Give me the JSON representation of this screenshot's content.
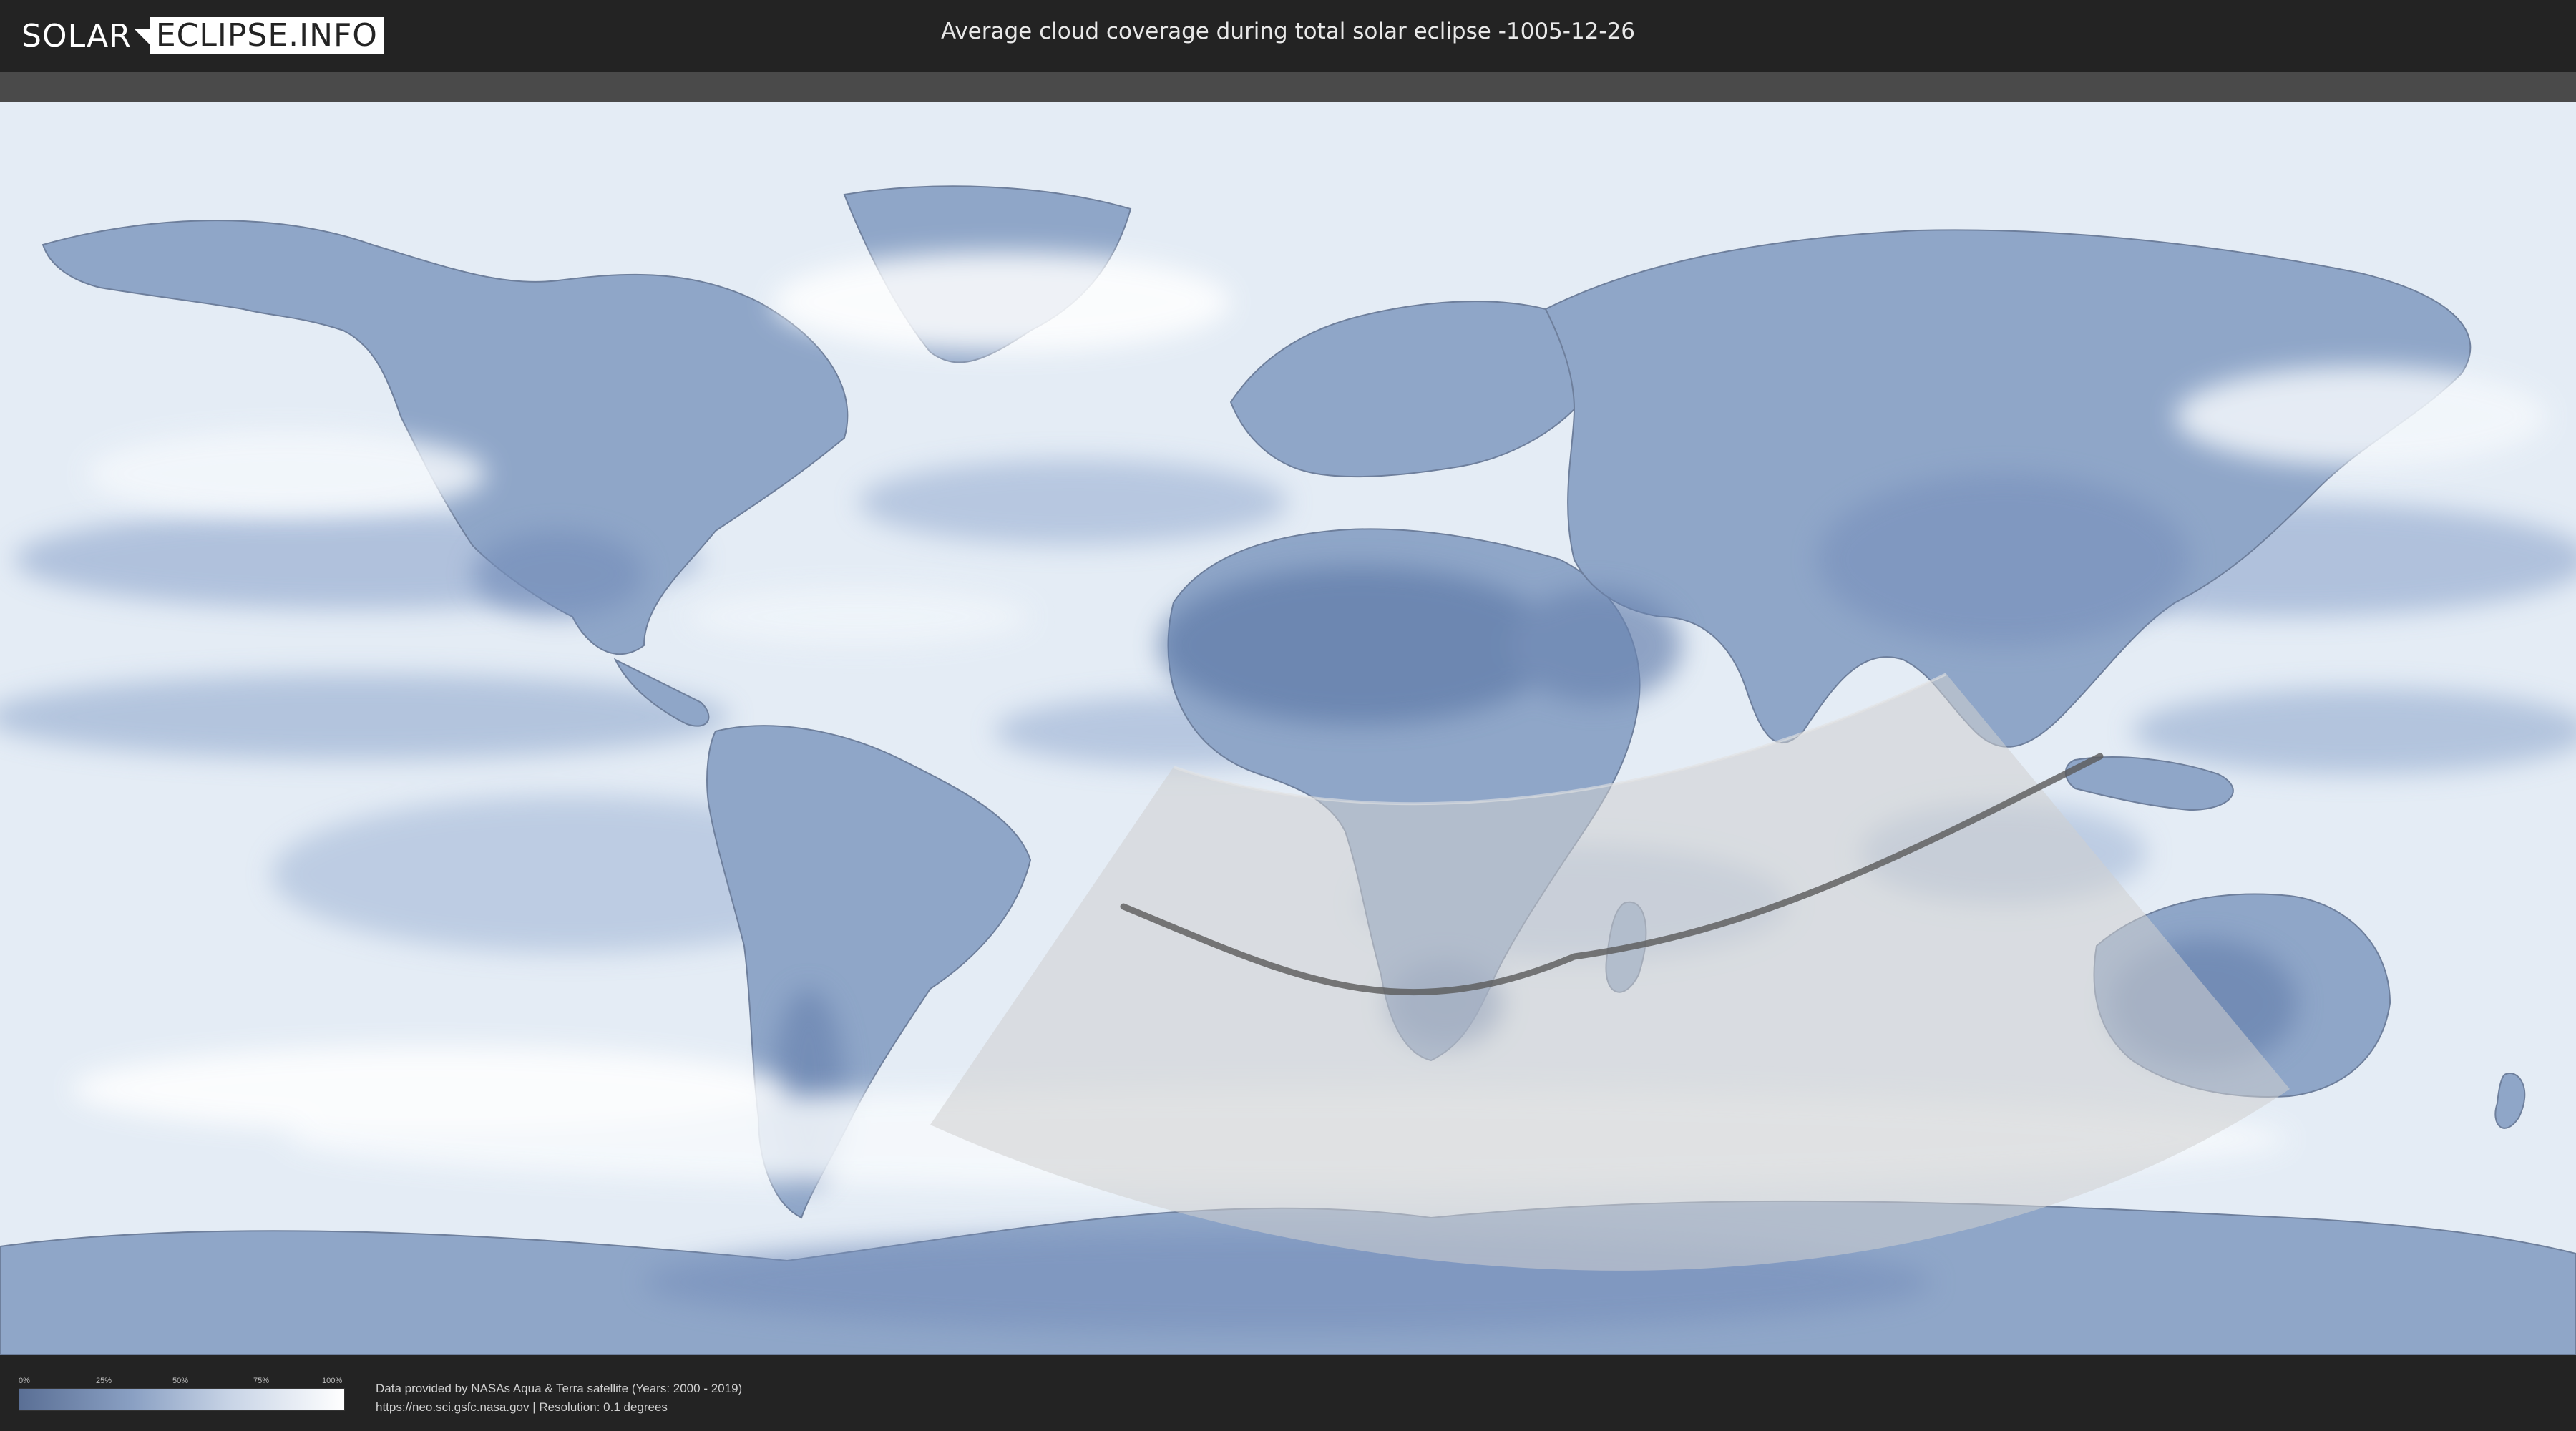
{
  "header": {
    "logo_part1": "SOLAR",
    "logo_part2": "ECLIPSE.INFO",
    "title": "Average cloud coverage during total solar eclipse -1005-12-26"
  },
  "legend": {
    "ticks": [
      "0%",
      "25%",
      "50%",
      "75%",
      "100%"
    ],
    "low_color": "#5a6f95",
    "high_color": "#ffffff"
  },
  "footer": {
    "credit_line1": "Data provided by NASAs Aqua & Terra satellite (Years: 2000 - 2019)",
    "credit_line2": "https://neo.sci.gsfc.nasa.gov | Resolution: 0.1 degrees"
  },
  "colors": {
    "background": "#232323",
    "ocean_clouds": "#dfe8f3",
    "land": "#8fa6c8",
    "dry_land": "#6d86b2",
    "eclipse_zone": "#d6d6d6",
    "eclipse_path": "#555555"
  }
}
